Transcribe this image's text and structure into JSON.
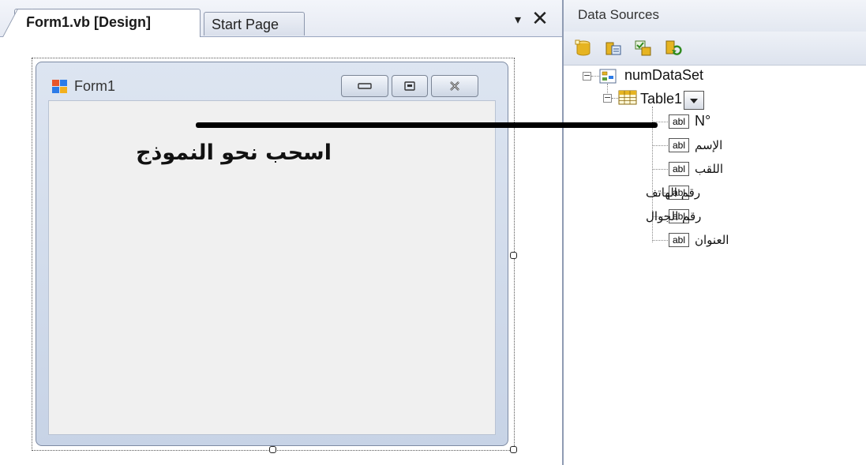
{
  "document": {
    "tabs": [
      {
        "label": "Form1.vb [Design]",
        "active": true
      },
      {
        "label": "Start Page",
        "active": false
      }
    ],
    "dropdown_glyph": "▾",
    "close_glyph": "✕"
  },
  "form": {
    "title": "Form1",
    "caption_buttons": [
      "minimize",
      "maximize",
      "close"
    ],
    "instruction_text": "اسحب نحو النموذج"
  },
  "data_sources": {
    "title": "Data Sources",
    "toolbar_icons": [
      "add-datasource-icon",
      "edit-dataset-icon",
      "configure-dataset-icon",
      "refresh-icon"
    ],
    "tree": {
      "dataset": "numDataSet",
      "table": "Table1",
      "field_icon_text": "abl",
      "fields": [
        "N°",
        "الإسم",
        "اللقب",
        "رقم الهاتف",
        "رقم الجوال",
        "العنوان"
      ]
    }
  },
  "colors": {
    "accent_gold": "#e6b422",
    "window_frame": "#c7d3e6",
    "client_area": "#f0f0f0",
    "drag_line": "#000000"
  }
}
